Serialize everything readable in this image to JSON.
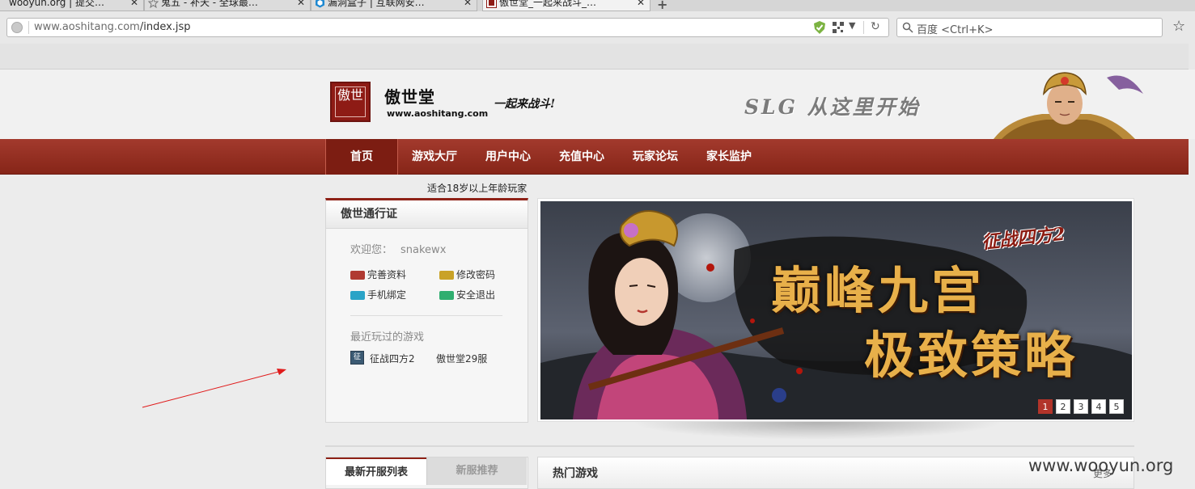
{
  "browser": {
    "tabs": [
      {
        "title": "wooyun.org | 提交…"
      },
      {
        "title": "鬼五 - 补天 - 全球最…"
      },
      {
        "title": "漏洞盒子 | 互联网安…"
      },
      {
        "title": "傲世堂_一起来战斗_…"
      }
    ],
    "url_domain": "www.aoshitang.com",
    "url_path": "/index.jsp",
    "search_placeholder": "百度 <Ctrl+K>"
  },
  "header": {
    "logo_text": "傲世",
    "brand_name": "傲世堂",
    "brand_url": "www.aoshitang.com",
    "slogan_small": "一起来战斗!",
    "slogan_big": "SLG 从这里开始"
  },
  "nav": {
    "items": [
      "首页",
      "游戏大厅",
      "用户中心",
      "充值中心",
      "玩家论坛",
      "家长监护"
    ],
    "active_index": 0
  },
  "age_note": "适合18岁以上年龄玩家",
  "passport": {
    "title": "傲世通行证",
    "welcome_label": "欢迎您：",
    "username": "snakewx",
    "actions": [
      {
        "label": "完善资料",
        "color": "#b03a32"
      },
      {
        "label": "修改密码",
        "color": "#c9a227"
      },
      {
        "label": "手机绑定",
        "color": "#2aa3c7"
      },
      {
        "label": "安全退出",
        "color": "#2fae6f"
      }
    ],
    "recent_title": "最近玩过的游戏",
    "recent_game_icon": "征",
    "recent_game": "征战四方2",
    "recent_server": "傲世堂29服"
  },
  "banner": {
    "tag": "征战四方2",
    "headline1": "巅峰九宫",
    "headline2": "极致策略",
    "pages": [
      "1",
      "2",
      "3",
      "4",
      "5"
    ],
    "current_page": 1
  },
  "bottom": {
    "tab_new_servers": "最新开服列表",
    "tab_new_recommend": "新服推荐",
    "hot_games": "热门游戏",
    "more": "更多"
  },
  "watermark": "www.wooyun.org",
  "colors": {
    "brand_red": "#8e2117",
    "nav_red": "#a33a2d",
    "headline_gold": "#e8b04a"
  }
}
